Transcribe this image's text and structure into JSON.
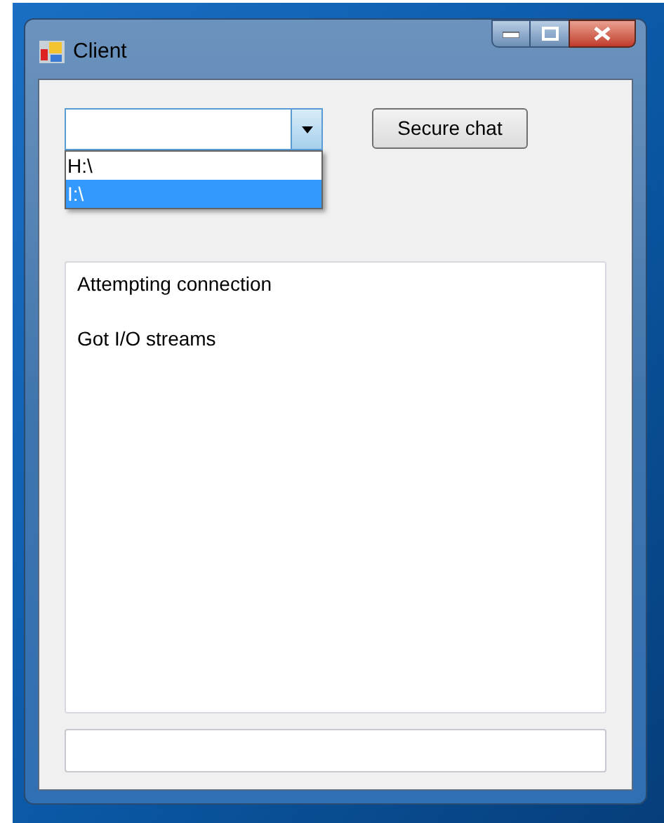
{
  "window": {
    "title": "Client"
  },
  "drive_combo": {
    "options": [
      {
        "label": "H:\\",
        "selected": false
      },
      {
        "label": "I:\\",
        "selected": true
      }
    ]
  },
  "secure_chat_button": "Secure chat",
  "log": [
    "Attempting connection",
    "Got I/O streams"
  ]
}
